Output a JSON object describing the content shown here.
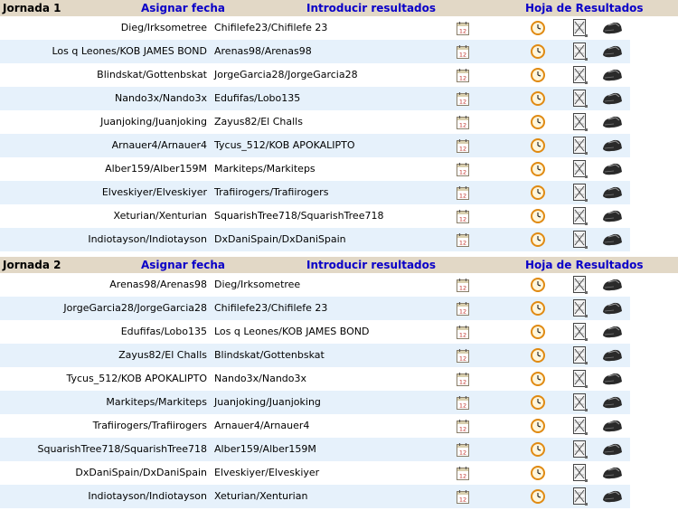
{
  "jornadas": [
    {
      "title": "Jornada 1",
      "assign_date": "Asignar fecha",
      "enter_results": "Introducir resultados",
      "results_sheet": "Hoja de Resultados",
      "matches": [
        {
          "home": "Dieg/Irksometree",
          "away": "Chifilefe23/Chifilefe 23"
        },
        {
          "home": "Los q Leones/KOB JAMES BOND",
          "away": "Arenas98/Arenas98"
        },
        {
          "home": "Blindskat/Gottenbskat",
          "away": "JorgeGarcia28/JorgeGarcia28"
        },
        {
          "home": "Nando3x/Nando3x",
          "away": "Edufifas/Lobo135"
        },
        {
          "home": "Juanjoking/Juanjoking",
          "away": "Zayus82/El Challs"
        },
        {
          "home": "Arnauer4/Arnauer4",
          "away": "Tycus_512/KOB APOKALIPTO"
        },
        {
          "home": "Alber159/Alber159M",
          "away": "Markiteps/Markiteps"
        },
        {
          "home": "Elveskiyer/Elveskiyer",
          "away": "Trafiirogers/Trafiirogers"
        },
        {
          "home": "Xeturian/Xenturian",
          "away": "SquarishTree718/SquarishTree718"
        },
        {
          "home": "Indiotayson/Indiotayson",
          "away": "DxDaniSpain/DxDaniSpain"
        }
      ]
    },
    {
      "title": "Jornada 2",
      "assign_date": "Asignar fecha",
      "enter_results": "Introducir resultados",
      "results_sheet": "Hoja de Resultados",
      "matches": [
        {
          "home": "Arenas98/Arenas98",
          "away": "Dieg/Irksometree"
        },
        {
          "home": "JorgeGarcia28/JorgeGarcia28",
          "away": "Chifilefe23/Chifilefe 23"
        },
        {
          "home": "Edufifas/Lobo135",
          "away": "Los q Leones/KOB JAMES BOND"
        },
        {
          "home": "Zayus82/El Challs",
          "away": "Blindskat/Gottenbskat"
        },
        {
          "home": "Tycus_512/KOB APOKALIPTO",
          "away": "Nando3x/Nando3x"
        },
        {
          "home": "Markiteps/Markiteps",
          "away": "Juanjoking/Juanjoking"
        },
        {
          "home": "Trafiirogers/Trafiirogers",
          "away": "Arnauer4/Arnauer4"
        },
        {
          "home": "SquarishTree718/SquarishTree718",
          "away": "Alber159/Alber159M"
        },
        {
          "home": "DxDaniSpain/DxDaniSpain",
          "away": "Elveskiyer/Elveskiyer"
        },
        {
          "home": "Indiotayson/Indiotayson",
          "away": "Xeturian/Xenturian"
        }
      ]
    }
  ],
  "icons": {
    "calendar": "calendar-icon",
    "clock": "clock-icon",
    "sheet": "results-sheet-icon",
    "whistle": "whistle-icon"
  },
  "colors": {
    "header_bg": "#e2d8c6",
    "link": "#0a00c8",
    "alt_row": "#e6f1fb"
  }
}
